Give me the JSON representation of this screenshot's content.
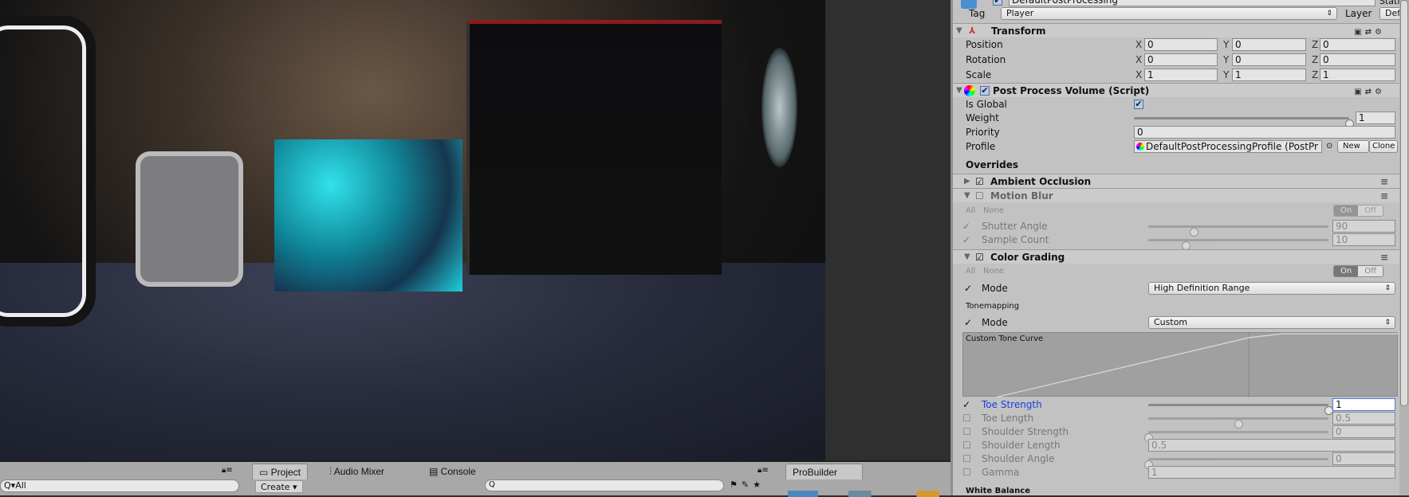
{
  "inspector": {
    "object_name": "DefaultPostProcessing",
    "static_label": "Static",
    "tag_label": "Tag",
    "tag_value": "Player",
    "layer_label": "Layer",
    "layer_value": "Default",
    "transform": {
      "title": "Transform",
      "rows": [
        {
          "label": "Position",
          "x": "0",
          "y": "0",
          "z": "0"
        },
        {
          "label": "Rotation",
          "x": "0",
          "y": "0",
          "z": "0"
        },
        {
          "label": "Scale",
          "x": "1",
          "y": "1",
          "z": "1"
        }
      ],
      "axis": {
        "x": "X",
        "y": "Y",
        "z": "Z"
      }
    },
    "ppv": {
      "title": "Post Process Volume (Script)",
      "enabled": true,
      "is_global_label": "Is Global",
      "is_global": true,
      "weight_label": "Weight",
      "weight": "1",
      "weight_fraction": 1.0,
      "priority_label": "Priority",
      "priority": "0",
      "profile_label": "Profile",
      "profile": "DefaultPostProcessingProfile (PostPr",
      "new_label": "New",
      "clone_label": "Clone"
    },
    "overrides_label": "Overrides",
    "all_label": "All",
    "none_label": "None",
    "on_label": "On",
    "off_label": "Off",
    "ambient_occlusion": {
      "title": "Ambient Occlusion",
      "enabled": true
    },
    "motion_blur": {
      "title": "Motion Blur",
      "enabled": false,
      "shutter_angle_label": "Shutter Angle",
      "shutter_angle": "90",
      "shutter_angle_fraction": 0.25,
      "sample_count_label": "Sample Count",
      "sample_count": "10",
      "sample_count_fraction": 0.21
    },
    "color_grading": {
      "title": "Color Grading",
      "enabled": true,
      "mode_label": "Mode",
      "mode_value": "High Definition Range",
      "tonemapping_label": "Tonemapping",
      "tm_mode_label": "Mode",
      "tm_mode_value": "Custom",
      "curve_label": "Custom Tone Curve",
      "toe_strength_label": "Toe Strength",
      "toe_strength": "1",
      "toe_strength_fraction": 1.0,
      "toe_length_label": "Toe Length",
      "toe_length": "0.5",
      "toe_length_fraction": 0.5,
      "shoulder_strength_label": "Shoulder Strength",
      "shoulder_strength": "0",
      "shoulder_strength_fraction": 0.0,
      "shoulder_length_label": "Shoulder Length",
      "shoulder_length": "0.5",
      "shoulder_angle_label": "Shoulder Angle",
      "shoulder_angle": "0",
      "shoulder_angle_fraction": 0.0,
      "gamma_label": "Gamma",
      "gamma": "1",
      "white_balance_label": "White Balance"
    }
  },
  "bottom": {
    "hierarchy_search": "All",
    "tabs": [
      "Project",
      "Audio Mixer",
      "Console"
    ],
    "create_label": "Create",
    "probuilder_tab": "ProBuilder"
  }
}
